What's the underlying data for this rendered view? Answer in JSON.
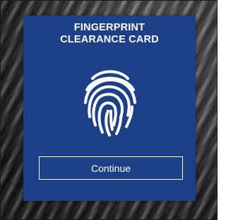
{
  "card": {
    "title_line1": "FINGERPRINT",
    "title_line2": "CLEARANCE CARD",
    "icon": "fingerprint-icon",
    "continue_label": "Continue",
    "background_color": "#1d3f86",
    "text_color": "#ffffff"
  }
}
